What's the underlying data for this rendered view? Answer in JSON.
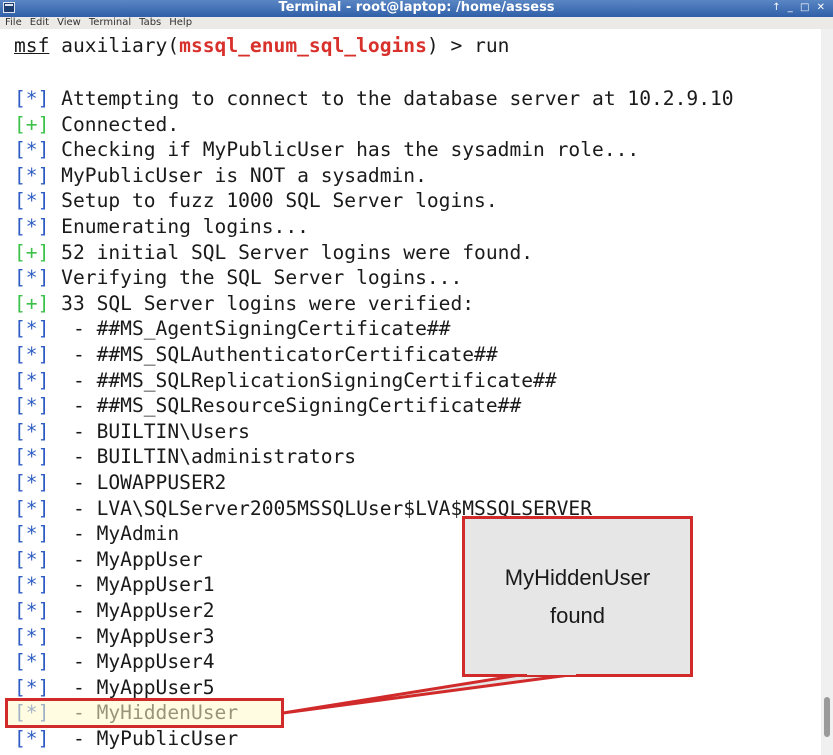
{
  "window": {
    "title": "Terminal - root@laptop: /home/assess",
    "controls": "↑ _ □ ✕"
  },
  "menu": [
    "File",
    "Edit",
    "View",
    "Terminal",
    "Tabs",
    "Help"
  ],
  "prompt": {
    "pre": "msf",
    "mid": " auxiliary(",
    "module": "mssql_enum_sql_logins",
    "post": ") > run"
  },
  "lines": [
    {
      "tag": "[*]",
      "text": " Attempting to connect to the database server at 10.2.9.10"
    },
    {
      "tag": "[+]",
      "text": " Connected."
    },
    {
      "tag": "[*]",
      "text": " Checking if MyPublicUser has the sysadmin role..."
    },
    {
      "tag": "[*]",
      "text": " MyPublicUser is NOT a sysadmin."
    },
    {
      "tag": "[*]",
      "text": " Setup to fuzz 1000 SQL Server logins."
    },
    {
      "tag": "[*]",
      "text": " Enumerating logins..."
    },
    {
      "tag": "[+]",
      "text": " 52 initial SQL Server logins were found."
    },
    {
      "tag": "[*]",
      "text": " Verifying the SQL Server logins..."
    },
    {
      "tag": "[+]",
      "text": " 33 SQL Server logins were verified:"
    },
    {
      "tag": "[*]",
      "text": "  - ##MS_AgentSigningCertificate##"
    },
    {
      "tag": "[*]",
      "text": "  - ##MS_SQLAuthenticatorCertificate##"
    },
    {
      "tag": "[*]",
      "text": "  - ##MS_SQLReplicationSigningCertificate##"
    },
    {
      "tag": "[*]",
      "text": "  - ##MS_SQLResourceSigningCertificate##"
    },
    {
      "tag": "[*]",
      "text": "  - BUILTIN\\Users"
    },
    {
      "tag": "[*]",
      "text": "  - BUILTIN\\administrators"
    },
    {
      "tag": "[*]",
      "text": "  - LOWAPPUSER2"
    },
    {
      "tag": "[*]",
      "text": "  - LVA\\SQLServer2005MSSQLUser$LVA$MSSQLSERVER"
    },
    {
      "tag": "[*]",
      "text": "  - MyAdmin"
    },
    {
      "tag": "[*]",
      "text": "  - MyAppUser"
    },
    {
      "tag": "[*]",
      "text": "  - MyAppUser1"
    },
    {
      "tag": "[*]",
      "text": "  - MyAppUser2"
    },
    {
      "tag": "[*]",
      "text": "  - MyAppUser3"
    },
    {
      "tag": "[*]",
      "text": "  - MyAppUser4"
    },
    {
      "tag": "[*]",
      "text": "  - MyAppUser5"
    },
    {
      "tag": "[*]",
      "text": "  - MyHiddenUser"
    },
    {
      "tag": "[*]",
      "text": "  - MyPublicUser"
    }
  ],
  "callout": {
    "text_line1": "MyHiddenUser",
    "text_line2": "found"
  },
  "colors": {
    "info_tag": "#2e5cc4",
    "good_tag": "#3cc24a",
    "module": "#d8302b",
    "annotation": "#d12a2a"
  }
}
